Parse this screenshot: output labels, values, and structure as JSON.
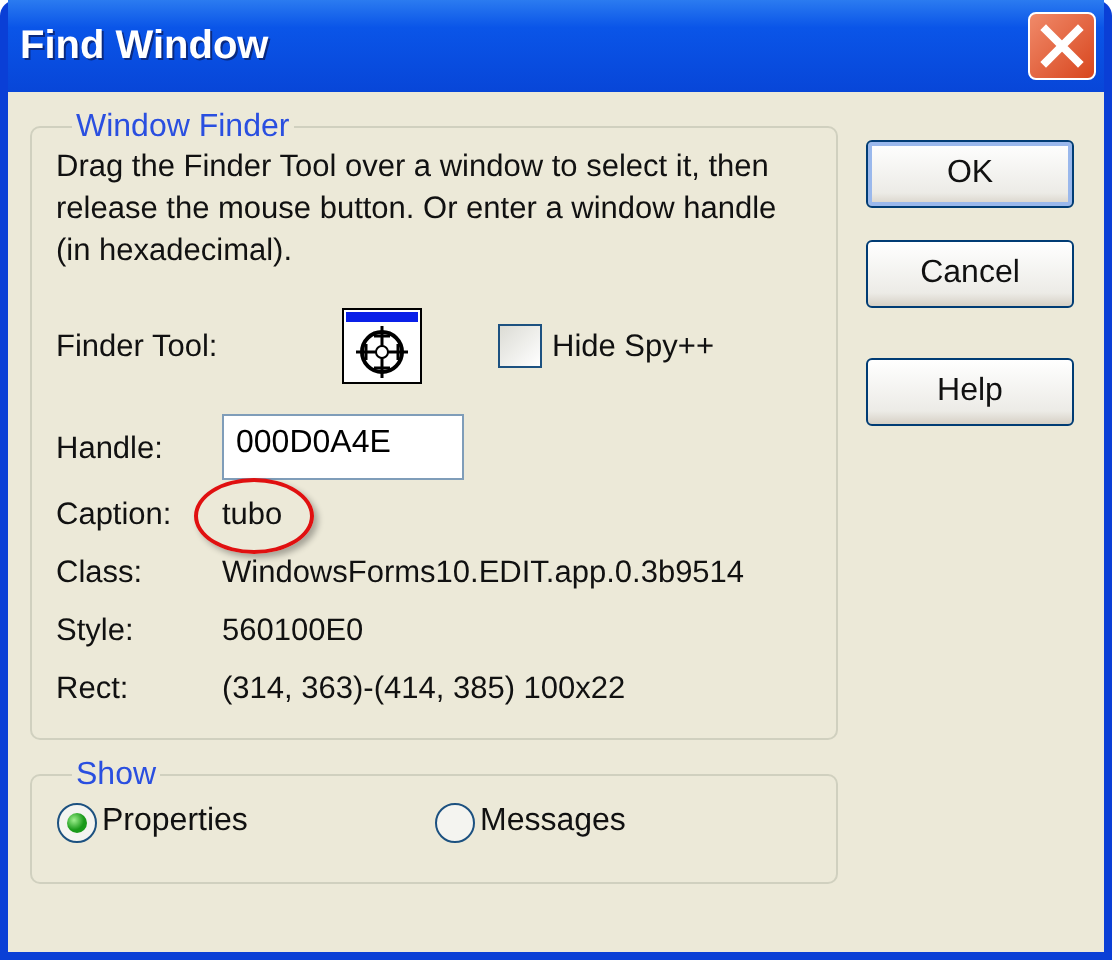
{
  "window": {
    "title": "Find Window"
  },
  "window_finder": {
    "title": "Window Finder",
    "description": "Drag the Finder Tool over a window to select it, then release the mouse button.  Or enter a window handle (in hexadecimal).",
    "finder_tool_label": "Finder Tool:",
    "hide_spy": {
      "label": "Hide Spy++",
      "checked": false
    },
    "handle": {
      "label": "Handle:",
      "value": "000D0A4E"
    },
    "properties": [
      {
        "label": "Caption:",
        "value": "tubo",
        "highlighted": true
      },
      {
        "label": "Class:",
        "value": "WindowsForms10.EDIT.app.0.3b9514",
        "highlighted": false
      },
      {
        "label": "Style:",
        "value": "560100E0",
        "highlighted": false
      },
      {
        "label": "Rect:",
        "value": "(314, 363)-(414, 385) 100x22",
        "highlighted": false
      }
    ]
  },
  "show": {
    "title": "Show",
    "options": [
      {
        "label": "Properties",
        "selected": true
      },
      {
        "label": "Messages",
        "selected": false
      }
    ]
  },
  "buttons": [
    {
      "label": "OK",
      "default": true
    },
    {
      "label": "Cancel",
      "default": false
    },
    {
      "label": "Help",
      "default": false
    }
  ]
}
